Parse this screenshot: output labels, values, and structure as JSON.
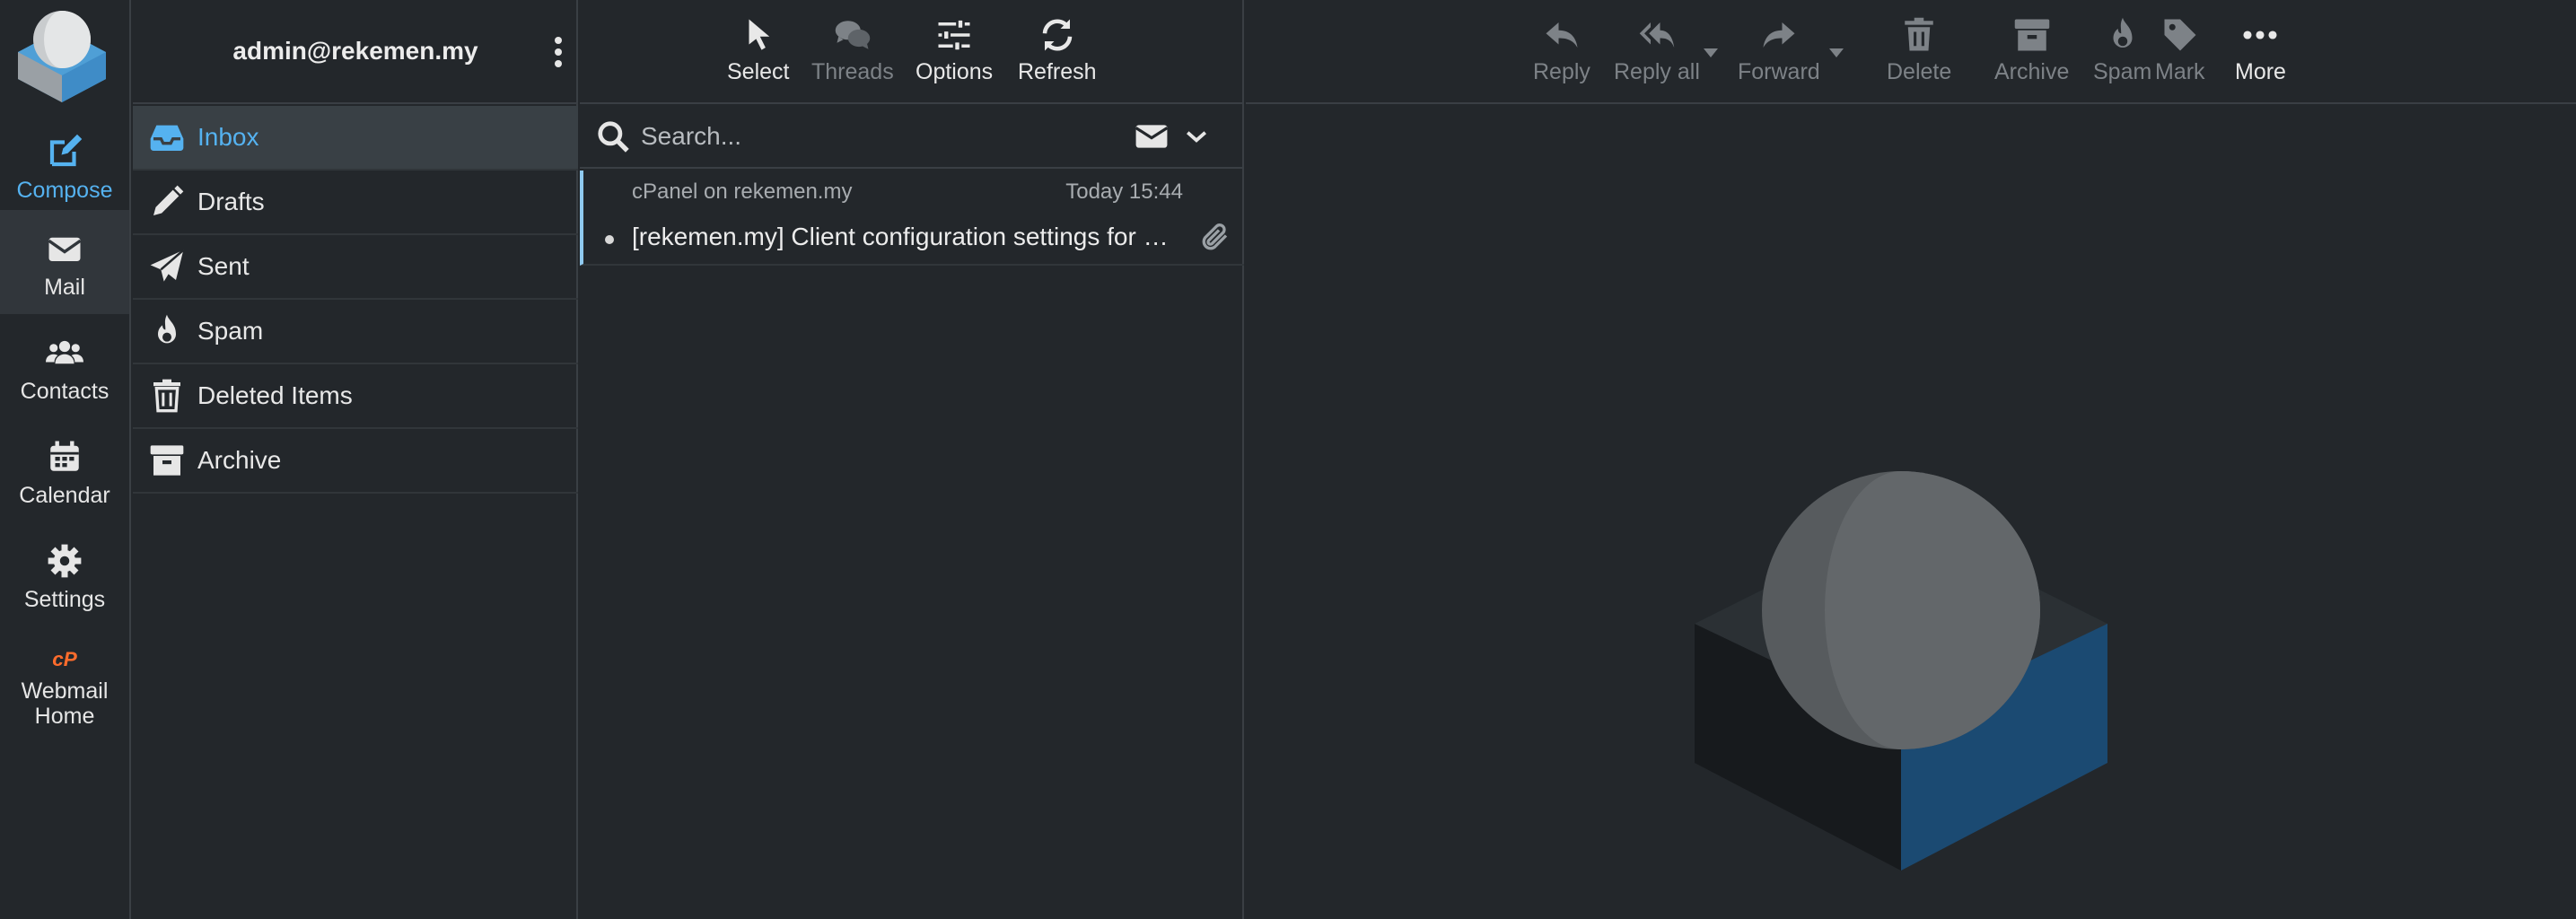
{
  "rail": {
    "items": [
      {
        "label": "Compose",
        "icon": "compose-icon"
      },
      {
        "label": "Mail",
        "icon": "mail-icon"
      },
      {
        "label": "Contacts",
        "icon": "contacts-icon"
      },
      {
        "label": "Calendar",
        "icon": "calendar-icon"
      },
      {
        "label": "Settings",
        "icon": "gear-icon"
      },
      {
        "label": "Webmail Home",
        "icon": "cpanel-icon"
      }
    ]
  },
  "account": {
    "email": "admin@rekemen.my"
  },
  "folders": [
    {
      "label": "Inbox",
      "icon": "inbox-icon",
      "selected": true
    },
    {
      "label": "Drafts",
      "icon": "pencil-icon"
    },
    {
      "label": "Sent",
      "icon": "paper-plane-icon"
    },
    {
      "label": "Spam",
      "icon": "fire-icon"
    },
    {
      "label": "Deleted Items",
      "icon": "trash-icon"
    },
    {
      "label": "Archive",
      "icon": "archive-icon"
    }
  ],
  "list_toolbar": {
    "select": "Select",
    "threads": "Threads",
    "options": "Options",
    "refresh": "Refresh"
  },
  "search": {
    "placeholder": "Search..."
  },
  "messages": [
    {
      "from": "cPanel on rekemen.my",
      "date": "Today 15:44",
      "subject": "[rekemen.my] Client configuration settings for “admin@rekemen.my”",
      "unread": true,
      "has_attachment": true
    }
  ],
  "preview_toolbar": {
    "reply": "Reply",
    "reply_all": "Reply all",
    "forward": "Forward",
    "delete": "Delete",
    "archive": "Archive",
    "spam": "Spam",
    "mark": "Mark",
    "more": "More"
  },
  "colors": {
    "accent": "#55b2f0",
    "background": "#23272b",
    "border": "#3a3f44",
    "brand_blue": "#1b4a72",
    "cpanel_orange": "#ff6c2c"
  }
}
